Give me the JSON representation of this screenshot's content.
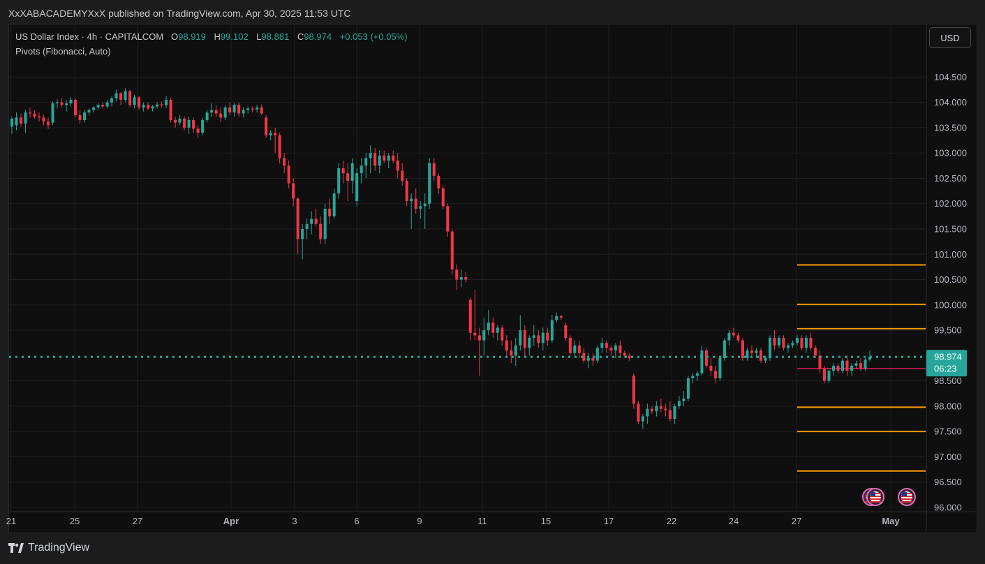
{
  "publisher_line": "XxXABACADEMYXxX published on TradingView.com, Apr 30, 2025 11:53 UTC",
  "legend": {
    "symbol": "US Dollar Index · 4h · CAPITALCOM",
    "open_label": "O",
    "open": "98.919",
    "high_label": "H",
    "high": "99.102",
    "low_label": "L",
    "low": "98.881",
    "close_label": "C",
    "close": "98.974",
    "change": "+0.053 (+0.05%)",
    "indicator": "Pivots (Fibonacci, Auto)"
  },
  "currency_button": "USD",
  "price_badge": {
    "price": "98.974",
    "countdown": "06:23"
  },
  "footer": {
    "brand": "TradingView"
  },
  "colors": {
    "up": "#26a69a",
    "down": "#f23645",
    "pivot": "#ff9800",
    "current_line": "#26a69a",
    "pink_line": "#e91e63"
  },
  "chart_data": {
    "type": "candlestick",
    "ylim": [
      96.0,
      104.85
    ],
    "yticks": [
      "104.500",
      "104.000",
      "103.500",
      "103.000",
      "102.500",
      "102.000",
      "101.500",
      "101.000",
      "100.500",
      "100.000",
      "99.500",
      "98.500",
      "98.000",
      "97.500",
      "97.000",
      "96.500",
      "96.000"
    ],
    "xticks": [
      "21",
      "25",
      "27",
      "Apr",
      "3",
      "6",
      "9",
      "11",
      "15",
      "17",
      "22",
      "24",
      "27",
      "May"
    ],
    "current_price": 98.974,
    "pink_level": 98.74,
    "pivot_levels": [
      100.79,
      100.01,
      99.53,
      97.98,
      97.5,
      96.72
    ],
    "series": [
      {
        "o": 103.52,
        "h": 103.72,
        "l": 103.38,
        "c": 103.68
      },
      {
        "o": 103.55,
        "h": 103.8,
        "l": 103.45,
        "c": 103.7
      },
      {
        "o": 103.7,
        "h": 103.78,
        "l": 103.52,
        "c": 103.58
      },
      {
        "o": 103.58,
        "h": 103.85,
        "l": 103.4,
        "c": 103.8
      },
      {
        "o": 103.8,
        "h": 103.9,
        "l": 103.7,
        "c": 103.78
      },
      {
        "o": 103.78,
        "h": 103.85,
        "l": 103.68,
        "c": 103.72
      },
      {
        "o": 103.72,
        "h": 103.8,
        "l": 103.62,
        "c": 103.7
      },
      {
        "o": 103.7,
        "h": 103.76,
        "l": 103.55,
        "c": 103.62
      },
      {
        "o": 103.62,
        "h": 103.7,
        "l": 103.48,
        "c": 103.55
      },
      {
        "o": 103.6,
        "h": 104.02,
        "l": 103.55,
        "c": 103.98
      },
      {
        "o": 103.98,
        "h": 104.06,
        "l": 103.88,
        "c": 104.0
      },
      {
        "o": 104.0,
        "h": 104.08,
        "l": 103.9,
        "c": 103.95
      },
      {
        "o": 103.95,
        "h": 104.05,
        "l": 103.82,
        "c": 103.98
      },
      {
        "o": 103.98,
        "h": 104.1,
        "l": 103.92,
        "c": 104.05
      },
      {
        "o": 104.05,
        "h": 104.08,
        "l": 103.7,
        "c": 103.75
      },
      {
        "o": 103.75,
        "h": 103.85,
        "l": 103.58,
        "c": 103.65
      },
      {
        "o": 103.65,
        "h": 103.85,
        "l": 103.6,
        "c": 103.8
      },
      {
        "o": 103.8,
        "h": 103.88,
        "l": 103.74,
        "c": 103.85
      },
      {
        "o": 103.85,
        "h": 103.92,
        "l": 103.8,
        "c": 103.9
      },
      {
        "o": 103.9,
        "h": 103.98,
        "l": 103.85,
        "c": 103.95
      },
      {
        "o": 103.95,
        "h": 104.0,
        "l": 103.88,
        "c": 103.92
      },
      {
        "o": 103.92,
        "h": 104.05,
        "l": 103.88,
        "c": 104.0
      },
      {
        "o": 104.0,
        "h": 104.12,
        "l": 103.92,
        "c": 104.08
      },
      {
        "o": 104.08,
        "h": 104.25,
        "l": 104.02,
        "c": 104.18
      },
      {
        "o": 104.18,
        "h": 104.2,
        "l": 103.95,
        "c": 104.05
      },
      {
        "o": 104.05,
        "h": 104.28,
        "l": 104.0,
        "c": 104.22
      },
      {
        "o": 104.22,
        "h": 104.25,
        "l": 103.9,
        "c": 103.95
      },
      {
        "o": 103.95,
        "h": 104.15,
        "l": 103.88,
        "c": 104.1
      },
      {
        "o": 104.1,
        "h": 104.12,
        "l": 103.85,
        "c": 103.9
      },
      {
        "o": 103.9,
        "h": 104.0,
        "l": 103.82,
        "c": 103.95
      },
      {
        "o": 103.95,
        "h": 104.0,
        "l": 103.85,
        "c": 103.88
      },
      {
        "o": 103.88,
        "h": 103.95,
        "l": 103.82,
        "c": 103.92
      },
      {
        "o": 103.92,
        "h": 104.0,
        "l": 103.88,
        "c": 103.96
      },
      {
        "o": 103.96,
        "h": 104.02,
        "l": 103.9,
        "c": 103.94
      },
      {
        "o": 103.94,
        "h": 104.12,
        "l": 103.88,
        "c": 104.05
      },
      {
        "o": 104.05,
        "h": 104.08,
        "l": 103.6,
        "c": 103.65
      },
      {
        "o": 103.65,
        "h": 103.72,
        "l": 103.5,
        "c": 103.6
      },
      {
        "o": 103.6,
        "h": 103.75,
        "l": 103.55,
        "c": 103.68
      },
      {
        "o": 103.68,
        "h": 103.72,
        "l": 103.45,
        "c": 103.5
      },
      {
        "o": 103.5,
        "h": 103.72,
        "l": 103.38,
        "c": 103.65
      },
      {
        "o": 103.65,
        "h": 103.7,
        "l": 103.4,
        "c": 103.48
      },
      {
        "o": 103.48,
        "h": 103.55,
        "l": 103.3,
        "c": 103.4
      },
      {
        "o": 103.4,
        "h": 103.7,
        "l": 103.35,
        "c": 103.65
      },
      {
        "o": 103.65,
        "h": 103.85,
        "l": 103.6,
        "c": 103.8
      },
      {
        "o": 103.8,
        "h": 103.98,
        "l": 103.72,
        "c": 103.85
      },
      {
        "o": 103.85,
        "h": 103.95,
        "l": 103.72,
        "c": 103.78
      },
      {
        "o": 103.78,
        "h": 103.9,
        "l": 103.62,
        "c": 103.7
      },
      {
        "o": 103.7,
        "h": 103.95,
        "l": 103.65,
        "c": 103.9
      },
      {
        "o": 103.9,
        "h": 104.0,
        "l": 103.75,
        "c": 103.8
      },
      {
        "o": 103.8,
        "h": 103.98,
        "l": 103.72,
        "c": 103.95
      },
      {
        "o": 103.95,
        "h": 104.0,
        "l": 103.72,
        "c": 103.78
      },
      {
        "o": 103.78,
        "h": 103.9,
        "l": 103.7,
        "c": 103.85
      },
      {
        "o": 103.85,
        "h": 103.92,
        "l": 103.78,
        "c": 103.88
      },
      {
        "o": 103.88,
        "h": 103.92,
        "l": 103.8,
        "c": 103.86
      },
      {
        "o": 103.86,
        "h": 103.95,
        "l": 103.8,
        "c": 103.9
      },
      {
        "o": 103.9,
        "h": 103.96,
        "l": 103.75,
        "c": 103.78
      },
      {
        "o": 103.7,
        "h": 103.75,
        "l": 103.3,
        "c": 103.35
      },
      {
        "o": 103.35,
        "h": 103.45,
        "l": 103.25,
        "c": 103.4
      },
      {
        "o": 103.4,
        "h": 103.5,
        "l": 103.0,
        "c": 103.35
      },
      {
        "o": 103.35,
        "h": 103.4,
        "l": 102.8,
        "c": 102.9
      },
      {
        "o": 102.9,
        "h": 103.0,
        "l": 102.6,
        "c": 102.75
      },
      {
        "o": 102.75,
        "h": 102.85,
        "l": 102.3,
        "c": 102.4
      },
      {
        "o": 102.4,
        "h": 102.5,
        "l": 101.95,
        "c": 102.1
      },
      {
        "o": 102.1,
        "h": 102.12,
        "l": 101.0,
        "c": 101.3
      },
      {
        "o": 101.3,
        "h": 101.6,
        "l": 100.9,
        "c": 101.5
      },
      {
        "o": 101.5,
        "h": 101.7,
        "l": 101.3,
        "c": 101.6
      },
      {
        "o": 101.6,
        "h": 101.85,
        "l": 101.4,
        "c": 101.7
      },
      {
        "o": 101.7,
        "h": 101.9,
        "l": 101.55,
        "c": 101.6
      },
      {
        "o": 101.6,
        "h": 101.75,
        "l": 101.2,
        "c": 101.3
      },
      {
        "o": 101.3,
        "h": 102.0,
        "l": 101.2,
        "c": 101.9
      },
      {
        "o": 101.9,
        "h": 102.1,
        "l": 101.6,
        "c": 101.75
      },
      {
        "o": 101.75,
        "h": 102.3,
        "l": 101.7,
        "c": 102.2
      },
      {
        "o": 102.2,
        "h": 102.8,
        "l": 102.1,
        "c": 102.7
      },
      {
        "o": 102.7,
        "h": 102.85,
        "l": 102.4,
        "c": 102.6
      },
      {
        "o": 102.6,
        "h": 102.8,
        "l": 102.05,
        "c": 102.45
      },
      {
        "o": 102.45,
        "h": 102.9,
        "l": 102.2,
        "c": 102.8
      },
      {
        "o": 102.05,
        "h": 102.7,
        "l": 101.95,
        "c": 102.6
      },
      {
        "o": 102.6,
        "h": 102.9,
        "l": 102.4,
        "c": 102.75
      },
      {
        "o": 102.75,
        "h": 103.0,
        "l": 102.5,
        "c": 102.9
      },
      {
        "o": 102.9,
        "h": 103.15,
        "l": 102.6,
        "c": 103.0
      },
      {
        "o": 103.0,
        "h": 103.1,
        "l": 102.65,
        "c": 102.75
      },
      {
        "o": 102.75,
        "h": 103.05,
        "l": 102.6,
        "c": 102.95
      },
      {
        "o": 102.95,
        "h": 103.05,
        "l": 102.8,
        "c": 102.85
      },
      {
        "o": 102.85,
        "h": 103.0,
        "l": 102.7,
        "c": 102.95
      },
      {
        "o": 102.95,
        "h": 103.05,
        "l": 102.8,
        "c": 102.85
      },
      {
        "o": 102.85,
        "h": 103.0,
        "l": 102.5,
        "c": 102.65
      },
      {
        "o": 102.65,
        "h": 102.8,
        "l": 102.35,
        "c": 102.45
      },
      {
        "o": 102.45,
        "h": 102.5,
        "l": 101.95,
        "c": 102.05
      },
      {
        "o": 102.05,
        "h": 102.2,
        "l": 101.5,
        "c": 102.1
      },
      {
        "o": 102.1,
        "h": 102.3,
        "l": 101.8,
        "c": 101.9
      },
      {
        "o": 101.9,
        "h": 102.05,
        "l": 101.7,
        "c": 101.95
      },
      {
        "o": 101.95,
        "h": 102.2,
        "l": 101.5,
        "c": 102.0
      },
      {
        "o": 102.0,
        "h": 102.9,
        "l": 101.9,
        "c": 102.8
      },
      {
        "o": 102.8,
        "h": 102.9,
        "l": 102.45,
        "c": 102.55
      },
      {
        "o": 102.55,
        "h": 102.6,
        "l": 102.2,
        "c": 102.3
      },
      {
        "o": 102.3,
        "h": 102.35,
        "l": 101.9,
        "c": 101.95
      },
      {
        "o": 101.95,
        "h": 102.0,
        "l": 101.35,
        "c": 101.45
      },
      {
        "o": 101.45,
        "h": 101.5,
        "l": 100.6,
        "c": 100.7
      },
      {
        "o": 100.7,
        "h": 100.8,
        "l": 100.3,
        "c": 100.5
      },
      {
        "o": 100.5,
        "h": 100.7,
        "l": 100.35,
        "c": 100.55
      },
      {
        "o": 100.55,
        "h": 100.65,
        "l": 100.45,
        "c": 100.5
      },
      {
        "o": 100.1,
        "h": 100.15,
        "l": 99.3,
        "c": 99.45
      },
      {
        "o": 99.45,
        "h": 100.3,
        "l": 99.3,
        "c": 99.4
      },
      {
        "o": 99.4,
        "h": 99.55,
        "l": 98.6,
        "c": 99.3
      },
      {
        "o": 99.3,
        "h": 99.75,
        "l": 99.0,
        "c": 99.5
      },
      {
        "o": 99.5,
        "h": 99.9,
        "l": 99.4,
        "c": 99.65
      },
      {
        "o": 99.65,
        "h": 99.75,
        "l": 99.35,
        "c": 99.45
      },
      {
        "o": 99.45,
        "h": 99.6,
        "l": 99.3,
        "c": 99.55
      },
      {
        "o": 99.55,
        "h": 99.6,
        "l": 99.2,
        "c": 99.3
      },
      {
        "o": 99.3,
        "h": 99.4,
        "l": 98.95,
        "c": 99.1
      },
      {
        "o": 99.1,
        "h": 99.3,
        "l": 98.85,
        "c": 99.0
      },
      {
        "o": 99.0,
        "h": 99.35,
        "l": 98.8,
        "c": 99.2
      },
      {
        "o": 99.2,
        "h": 99.8,
        "l": 99.1,
        "c": 99.5
      },
      {
        "o": 99.5,
        "h": 99.6,
        "l": 99.0,
        "c": 99.15
      },
      {
        "o": 99.15,
        "h": 99.4,
        "l": 99.0,
        "c": 99.35
      },
      {
        "o": 99.35,
        "h": 99.6,
        "l": 99.2,
        "c": 99.4
      },
      {
        "o": 99.4,
        "h": 99.5,
        "l": 99.15,
        "c": 99.25
      },
      {
        "o": 99.25,
        "h": 99.55,
        "l": 99.1,
        "c": 99.45
      },
      {
        "o": 99.45,
        "h": 99.55,
        "l": 99.2,
        "c": 99.3
      },
      {
        "o": 99.3,
        "h": 99.8,
        "l": 99.25,
        "c": 99.7
      },
      {
        "o": 99.7,
        "h": 99.85,
        "l": 99.65,
        "c": 99.78
      },
      {
        "o": 99.78,
        "h": 99.8,
        "l": 99.7,
        "c": 99.75
      },
      {
        "o": 99.6,
        "h": 99.65,
        "l": 99.3,
        "c": 99.35
      },
      {
        "o": 99.35,
        "h": 99.4,
        "l": 99.0,
        "c": 99.05
      },
      {
        "o": 99.05,
        "h": 99.3,
        "l": 98.95,
        "c": 99.2
      },
      {
        "o": 99.2,
        "h": 99.3,
        "l": 98.95,
        "c": 99.05
      },
      {
        "o": 99.05,
        "h": 99.15,
        "l": 98.85,
        "c": 98.9
      },
      {
        "o": 98.9,
        "h": 99.05,
        "l": 98.75,
        "c": 98.95
      },
      {
        "o": 98.95,
        "h": 99.05,
        "l": 98.8,
        "c": 98.9
      },
      {
        "o": 98.9,
        "h": 99.2,
        "l": 98.85,
        "c": 99.15
      },
      {
        "o": 99.15,
        "h": 99.35,
        "l": 99.05,
        "c": 99.25
      },
      {
        "o": 99.25,
        "h": 99.3,
        "l": 99.05,
        "c": 99.15
      },
      {
        "o": 99.15,
        "h": 99.2,
        "l": 99.0,
        "c": 99.1
      },
      {
        "o": 99.1,
        "h": 99.25,
        "l": 98.95,
        "c": 99.2
      },
      {
        "o": 99.2,
        "h": 99.3,
        "l": 98.95,
        "c": 99.05
      },
      {
        "o": 99.05,
        "h": 99.1,
        "l": 98.95,
        "c": 99.0
      },
      {
        "o": 99.0,
        "h": 99.05,
        "l": 98.9,
        "c": 98.95
      },
      {
        "o": 98.6,
        "h": 98.65,
        "l": 97.95,
        "c": 98.05
      },
      {
        "o": 98.05,
        "h": 98.1,
        "l": 97.65,
        "c": 97.7
      },
      {
        "o": 97.7,
        "h": 97.85,
        "l": 97.55,
        "c": 97.8
      },
      {
        "o": 97.8,
        "h": 98.05,
        "l": 97.65,
        "c": 97.95
      },
      {
        "o": 97.95,
        "h": 98.0,
        "l": 97.85,
        "c": 97.9
      },
      {
        "o": 97.9,
        "h": 98.1,
        "l": 97.8,
        "c": 98.0
      },
      {
        "o": 98.0,
        "h": 98.15,
        "l": 97.88,
        "c": 97.95
      },
      {
        "o": 97.95,
        "h": 98.05,
        "l": 97.8,
        "c": 97.92
      },
      {
        "o": 97.92,
        "h": 98.1,
        "l": 97.7,
        "c": 97.75
      },
      {
        "o": 97.75,
        "h": 98.05,
        "l": 97.65,
        "c": 98.0
      },
      {
        "o": 98.0,
        "h": 98.2,
        "l": 97.95,
        "c": 98.1
      },
      {
        "o": 98.1,
        "h": 98.3,
        "l": 98.0,
        "c": 98.15
      },
      {
        "o": 98.15,
        "h": 98.6,
        "l": 98.1,
        "c": 98.55
      },
      {
        "o": 98.55,
        "h": 98.65,
        "l": 98.45,
        "c": 98.6
      },
      {
        "o": 98.6,
        "h": 98.7,
        "l": 98.5,
        "c": 98.65
      },
      {
        "o": 98.65,
        "h": 99.2,
        "l": 98.6,
        "c": 99.1
      },
      {
        "o": 99.1,
        "h": 99.15,
        "l": 98.75,
        "c": 98.8
      },
      {
        "o": 98.8,
        "h": 98.95,
        "l": 98.6,
        "c": 98.7
      },
      {
        "o": 98.7,
        "h": 98.8,
        "l": 98.45,
        "c": 98.55
      },
      {
        "o": 98.55,
        "h": 99.0,
        "l": 98.5,
        "c": 98.95
      },
      {
        "o": 98.95,
        "h": 99.35,
        "l": 98.9,
        "c": 99.3
      },
      {
        "o": 99.3,
        "h": 99.5,
        "l": 99.2,
        "c": 99.45
      },
      {
        "o": 99.45,
        "h": 99.55,
        "l": 99.35,
        "c": 99.4
      },
      {
        "o": 99.4,
        "h": 99.45,
        "l": 99.25,
        "c": 99.3
      },
      {
        "o": 99.3,
        "h": 99.35,
        "l": 98.9,
        "c": 98.95
      },
      {
        "o": 98.95,
        "h": 99.15,
        "l": 98.9,
        "c": 99.1
      },
      {
        "o": 99.1,
        "h": 99.2,
        "l": 98.95,
        "c": 99.05
      },
      {
        "o": 99.05,
        "h": 99.15,
        "l": 98.95,
        "c": 99.1
      },
      {
        "o": 99.1,
        "h": 99.15,
        "l": 98.85,
        "c": 98.9
      },
      {
        "o": 98.9,
        "h": 99.0,
        "l": 98.85,
        "c": 98.95
      },
      {
        "o": 98.95,
        "h": 99.4,
        "l": 98.9,
        "c": 99.35
      },
      {
        "o": 99.35,
        "h": 99.5,
        "l": 99.1,
        "c": 99.2
      },
      {
        "o": 99.2,
        "h": 99.4,
        "l": 99.15,
        "c": 99.35
      },
      {
        "o": 99.35,
        "h": 99.4,
        "l": 99.1,
        "c": 99.15
      },
      {
        "o": 99.15,
        "h": 99.25,
        "l": 99.05,
        "c": 99.2
      },
      {
        "o": 99.2,
        "h": 99.3,
        "l": 99.15,
        "c": 99.25
      },
      {
        "o": 99.25,
        "h": 99.4,
        "l": 99.2,
        "c": 99.35
      },
      {
        "o": 99.35,
        "h": 99.4,
        "l": 99.1,
        "c": 99.15
      },
      {
        "o": 99.15,
        "h": 99.4,
        "l": 99.05,
        "c": 99.35
      },
      {
        "o": 99.35,
        "h": 99.45,
        "l": 99.1,
        "c": 99.15
      },
      {
        "o": 99.15,
        "h": 99.2,
        "l": 98.95,
        "c": 99.0
      },
      {
        "o": 99.0,
        "h": 99.1,
        "l": 98.65,
        "c": 98.75
      },
      {
        "o": 98.75,
        "h": 98.8,
        "l": 98.45,
        "c": 98.5
      },
      {
        "o": 98.5,
        "h": 98.75,
        "l": 98.45,
        "c": 98.7
      },
      {
        "o": 98.7,
        "h": 98.85,
        "l": 98.6,
        "c": 98.8
      },
      {
        "o": 98.8,
        "h": 98.85,
        "l": 98.65,
        "c": 98.7
      },
      {
        "o": 98.7,
        "h": 98.95,
        "l": 98.65,
        "c": 98.9
      },
      {
        "o": 98.9,
        "h": 99.0,
        "l": 98.6,
        "c": 98.7
      },
      {
        "o": 98.7,
        "h": 98.85,
        "l": 98.6,
        "c": 98.8
      },
      {
        "o": 98.8,
        "h": 98.9,
        "l": 98.75,
        "c": 98.85
      },
      {
        "o": 98.85,
        "h": 98.95,
        "l": 98.7,
        "c": 98.75
      },
      {
        "o": 98.75,
        "h": 98.95,
        "l": 98.7,
        "c": 98.92
      },
      {
        "o": 98.919,
        "h": 99.102,
        "l": 98.881,
        "c": 98.974
      }
    ]
  }
}
